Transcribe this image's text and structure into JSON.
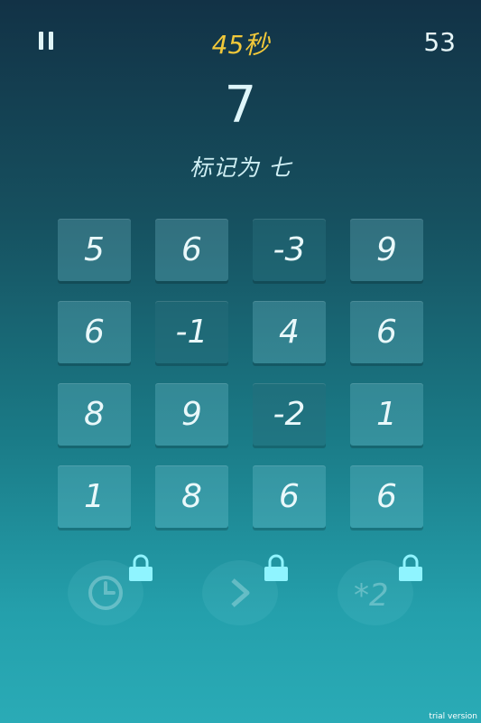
{
  "header": {
    "timer": "45秒",
    "score": "53"
  },
  "target_number": "7",
  "instruction": "标记为 七",
  "grid": [
    [
      "5",
      "6",
      "-3",
      "9"
    ],
    [
      "6",
      "-1",
      "4",
      "6"
    ],
    [
      "8",
      "9",
      "-2",
      "1"
    ],
    [
      "1",
      "8",
      "6",
      "6"
    ]
  ],
  "powerups": [
    {
      "icon": "clock-icon",
      "locked": true
    },
    {
      "icon": "skip-arrow-icon",
      "locked": true
    },
    {
      "icon": "multiply-two-icon",
      "label": "*2",
      "locked": true
    }
  ],
  "watermark": "trial version",
  "colors": {
    "timer": "#f1c83a",
    "lock_glow": "#8ff4ff"
  }
}
